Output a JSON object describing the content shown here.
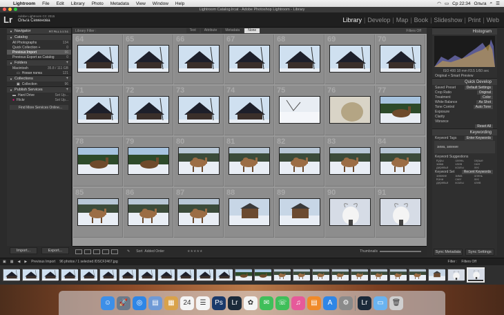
{
  "menubar": {
    "apple": "",
    "items": [
      "Lightroom",
      "File",
      "Edit",
      "Library",
      "Photo",
      "Metadata",
      "View",
      "Window",
      "Help"
    ],
    "clock": "Ср 22:34",
    "user": "Ольга"
  },
  "window_title": "Lightroom Catalog.lrcat - Adobe Photoshop Lightroom - Library",
  "identity": {
    "logo": "Lr",
    "version": "Adobe Lightroom CC 2015",
    "user_name": "Ольга Семенова",
    "modules": [
      "Library",
      "Develop",
      "Map",
      "Book",
      "Slideshow",
      "Print",
      "Web"
    ],
    "active_module": "Library"
  },
  "left_panel": {
    "navigator": "Navigator",
    "navigator_opts": "FIT  FILL  1:1  3:1",
    "catalog": "Catalog",
    "catalog_items": [
      {
        "label": "All Photographs",
        "count": "134"
      },
      {
        "label": "Quick Collection +",
        "count": "0"
      },
      {
        "label": "Previous Import",
        "count": "96"
      },
      {
        "label": "Previous Export as Catalog",
        "count": "0"
      }
    ],
    "folders": "Folders",
    "folder_drive": "Macintosh",
    "folder_drive_info": "35.8 / 111 GB",
    "folder_items": [
      {
        "label": "Новая папка",
        "count": "121"
      }
    ],
    "collections": "Collections",
    "collection_items": [
      {
        "label": "Collection",
        "count": "96"
      }
    ],
    "publish": "Publish Services",
    "publish_items": [
      {
        "label": "Hard Drive",
        "count": "Set Up..."
      },
      {
        "label": "Flickr",
        "count": "Set Up..."
      }
    ],
    "find_more": "Find More Services Online...",
    "import_btn": "Import...",
    "export_btn": "Export..."
  },
  "filter_bar": {
    "label": "Library Filter :",
    "tabs": [
      "Text",
      "Attribute",
      "Metadata",
      "None"
    ],
    "active_tab": "None",
    "filters_off": "Filters Off"
  },
  "grid": {
    "cells": [
      {
        "n": "64",
        "scene": "house"
      },
      {
        "n": "65",
        "scene": "house"
      },
      {
        "n": "66",
        "scene": "house"
      },
      {
        "n": "67",
        "scene": "house"
      },
      {
        "n": "68",
        "scene": "house"
      },
      {
        "n": "69",
        "scene": "house"
      },
      {
        "n": "70",
        "scene": "house"
      },
      {
        "n": "71",
        "scene": "house"
      },
      {
        "n": "72",
        "scene": "house"
      },
      {
        "n": "73",
        "scene": "house"
      },
      {
        "n": "74",
        "scene": "house"
      },
      {
        "n": "75",
        "scene": "snow"
      },
      {
        "n": "76",
        "scene": "camel-close"
      },
      {
        "n": "77",
        "scene": "elk"
      },
      {
        "n": "78",
        "scene": "elk"
      },
      {
        "n": "79",
        "scene": "elk"
      },
      {
        "n": "80",
        "scene": "camel"
      },
      {
        "n": "81",
        "scene": "camel"
      },
      {
        "n": "82",
        "scene": "camel"
      },
      {
        "n": "83",
        "scene": "camel"
      },
      {
        "n": "84",
        "scene": "camel"
      },
      {
        "n": "85",
        "scene": "camel"
      },
      {
        "n": "86",
        "scene": "camel"
      },
      {
        "n": "87",
        "scene": "camel"
      },
      {
        "n": "88",
        "scene": "hut"
      },
      {
        "n": "89",
        "scene": "hut"
      },
      {
        "n": "90",
        "scene": "goat"
      },
      {
        "n": "91",
        "scene": "goat"
      }
    ]
  },
  "toolbar": {
    "sort_label": "Sort",
    "sort_value": "Added Order",
    "thumbnails_label": "Thumbnails"
  },
  "right_panel": {
    "histogram": "Histogram",
    "histo_info": "ISO 400   18 mm   f/3.5   1/60 sec",
    "original_preview": "Original + Smart Preview",
    "quick_develop": "Quick Develop",
    "saved_preset": {
      "label": "Saved Preset",
      "value": "Default Settings"
    },
    "crop_ratio": {
      "label": "Crop Ratio",
      "value": "Original"
    },
    "treatment": {
      "label": "Treatment",
      "value": "Color"
    },
    "white_balance": {
      "label": "White Balance",
      "value": "As Shot"
    },
    "tone_control": {
      "label": "Tone Control",
      "value": "Auto Tone"
    },
    "exposure": "Exposure",
    "clarity": "Clarity",
    "vibrance": "Vibrance",
    "reset_all": "Reset All",
    "keywording": "Keywording",
    "keyword_tags": {
      "label": "Keyword Tags",
      "value": "Enter Keywords"
    },
    "keywords_text": "зима, зимние",
    "keyword_suggestions": "Keyword Suggestions",
    "suggestions": [
      "Куры",
      "олень",
      "серые",
      "зима",
      "хлев",
      "снег",
      "деревья",
      "козлы",
      "лес"
    ],
    "keyword_set": {
      "label": "Keyword Set",
      "value": "Recent Keywords"
    },
    "set_words": [
      "зимние",
      "зима",
      "олень",
      "Кони",
      "снег",
      "лес",
      "деревья",
      "козлы",
      "хлев"
    ],
    "sync_btn": "Sync Metadata",
    "sync_settings": "Sync Settings"
  },
  "filmbar": {
    "source": "Previous Import",
    "info": "96 photos / 1 selected /DSCF2467.jpg",
    "filter_label": "Filter :",
    "filter_value": "Filters Off"
  },
  "dock": {
    "apps": [
      "Finder",
      "Launchpad",
      "Safari",
      "Preview",
      "Notes",
      "Calendar",
      "Reminders",
      "Photoshop",
      "Lightroom",
      "Photos",
      "Messages",
      "FaceTime",
      "iTunes",
      "iBooks",
      "App Store",
      "System Preferences",
      "Lightroom",
      "Folder",
      "Trash"
    ],
    "calendar_day": "24"
  }
}
